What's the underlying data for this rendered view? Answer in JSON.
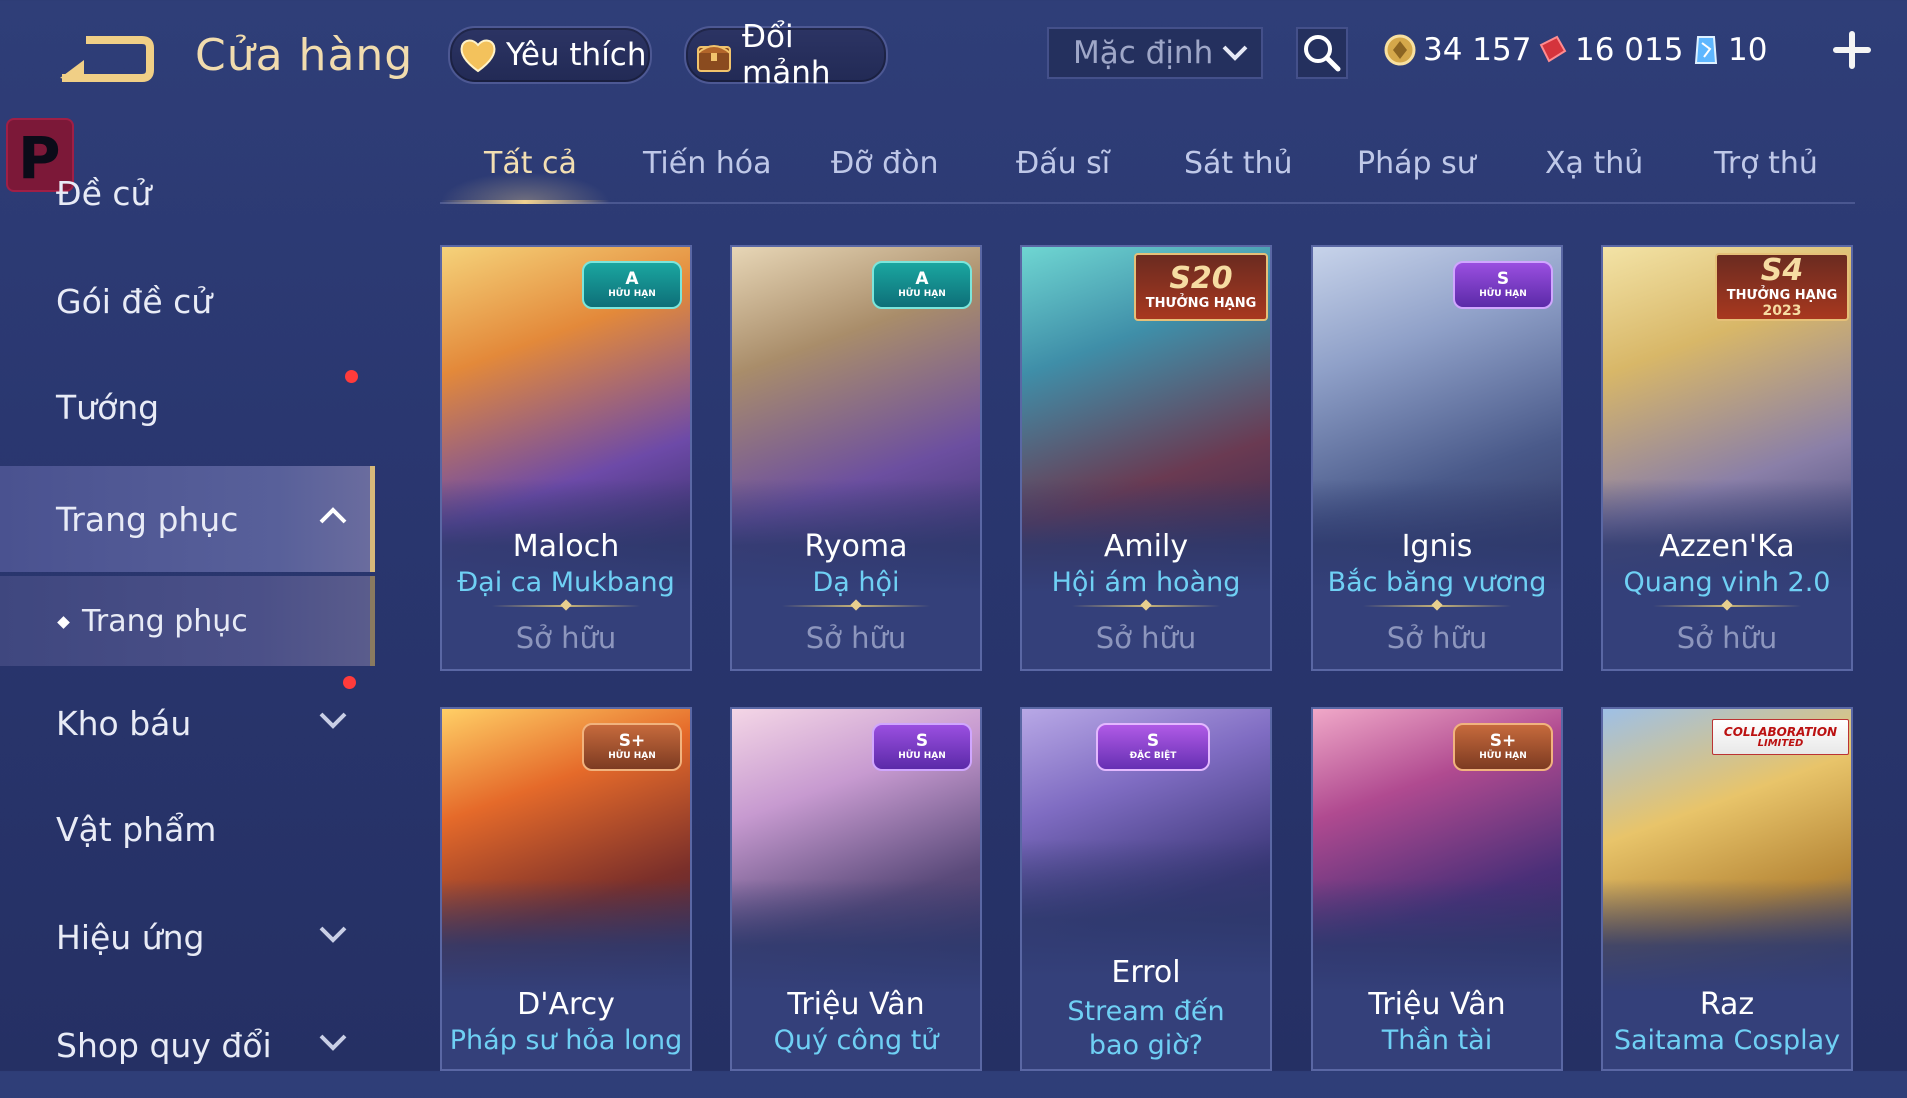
{
  "header": {
    "title": "Cửa hàng",
    "favorites_label": "Yêu thích",
    "fragments_label": "Đổi mảnh",
    "sort_selected": "Mặc định",
    "currency": {
      "gold": "34 157",
      "voucher": "16 015",
      "gem": "10"
    }
  },
  "logo_letter": "P",
  "sidebar": {
    "items": [
      {
        "label": "Đề cử"
      },
      {
        "label": "Gói đề cử"
      },
      {
        "label": "Tướng"
      },
      {
        "label": "Trang phục"
      },
      {
        "label": "Trang phục"
      },
      {
        "label": "Kho báu"
      },
      {
        "label": "Vật phẩm"
      },
      {
        "label": "Hiệu ứng"
      },
      {
        "label": "Shop quy đổi"
      }
    ]
  },
  "tabs": [
    "Tất cả",
    "Tiến hóa",
    "Đỡ đòn",
    "Đấu sĩ",
    "Sát thủ",
    "Pháp sư",
    "Xạ thủ",
    "Trợ thủ"
  ],
  "cards": [
    {
      "hero": "Maloch",
      "skin": "Đại ca Mukbang",
      "status": "Sở hữu",
      "badge_rank": "A",
      "badge_sub": "HỮU HẠN"
    },
    {
      "hero": "Ryoma",
      "skin": "Dạ hội",
      "status": "Sở hữu",
      "badge_rank": "A",
      "badge_sub": "HỮU HẠN"
    },
    {
      "hero": "Amily",
      "skin": "Hội ám hoàng",
      "status": "Sở hữu",
      "badge_rank": "S20",
      "badge_sub": "THƯỞNG HẠNG"
    },
    {
      "hero": "Ignis",
      "skin": "Bắc băng vương",
      "status": "Sở hữu",
      "badge_rank": "S",
      "badge_sub": "HỮU HẠN"
    },
    {
      "hero": "Azzen'Ka",
      "skin": "Quang vinh 2.0",
      "status": "Sở hữu",
      "badge_rank": "S4",
      "badge_sub": "THƯỞNG HẠNG",
      "badge_year": "2023"
    },
    {
      "hero": "D'Arcy",
      "skin": "Pháp sư hỏa long",
      "status": "",
      "badge_rank": "S+",
      "badge_sub": "HỮU HẠN"
    },
    {
      "hero": "Triệu Vân",
      "skin": "Quý công tử",
      "status": "",
      "badge_rank": "S",
      "badge_sub": "HỮU HẠN"
    },
    {
      "hero": "Errol",
      "skin": "Stream đến bao giờ?",
      "status": "",
      "badge_rank": "S",
      "badge_sub": "ĐẶC BIỆT"
    },
    {
      "hero": "Triệu Vân",
      "skin": "Thần tài",
      "status": "",
      "badge_rank": "S+",
      "badge_sub": "HỮU HẠN"
    },
    {
      "hero": "Raz",
      "skin": "Saitama Cosplay",
      "status": "",
      "badge_rank": "COLLABORATION",
      "badge_sub": "LIMITED"
    }
  ],
  "colors": {
    "accent_gold": "#f1dcae",
    "skin_name": "#6fd0f4",
    "notification": "#ff3b3b"
  }
}
